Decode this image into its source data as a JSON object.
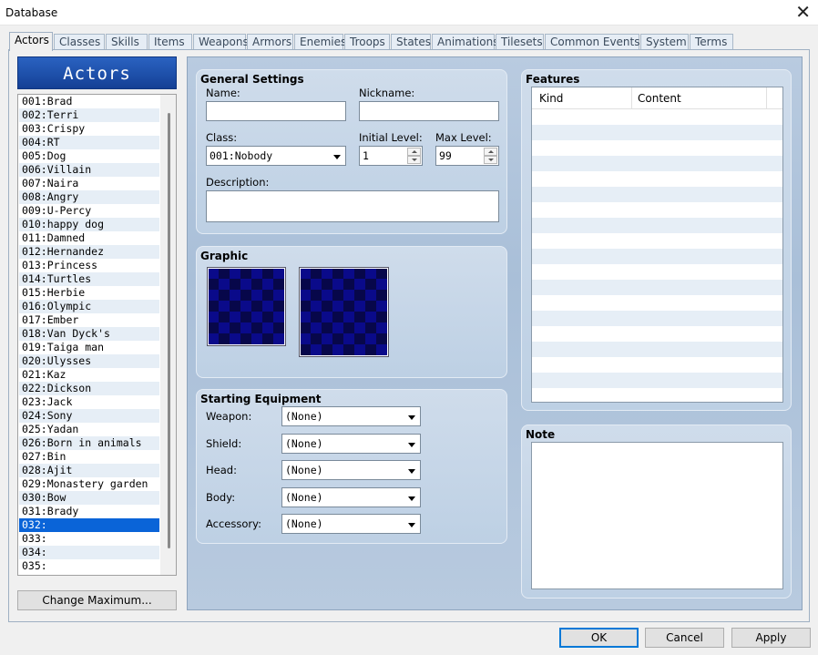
{
  "window": {
    "title": "Database",
    "close_glyph": "✕"
  },
  "tabs": [
    "Actors",
    "Classes",
    "Skills",
    "Items",
    "Weapons",
    "Armors",
    "Enemies",
    "Troops",
    "States",
    "Animations",
    "Tilesets",
    "Common Events",
    "System",
    "Terms"
  ],
  "active_tab": "Actors",
  "actors_panel": {
    "header": "Actors",
    "items": [
      "001:Brad",
      "002:Terri",
      "003:Crispy",
      "004:RT",
      "005:Dog",
      "006:Villain",
      "007:Naira",
      "008:Angry",
      "009:U-Percy",
      "010:happy dog",
      "011:Damned",
      "012:Hernandez",
      "013:Princess",
      "014:Turtles",
      "015:Herbie",
      "016:Olympic",
      "017:Ember",
      "018:Van Dyck's",
      "019:Taiga man",
      "020:Ulysses",
      "021:Kaz",
      "022:Dickson",
      "023:Jack",
      "024:Sony",
      "025:Yadan",
      "026:Born in animals",
      "027:Bin",
      "028:Ajit",
      "029:Monastery garden",
      "030:Bow",
      "031:Brady",
      "032:",
      "033:",
      "034:",
      "035:"
    ],
    "selected_index": 31,
    "change_max_label": "Change Maximum..."
  },
  "general": {
    "title": "General Settings",
    "name_label": "Name:",
    "name_value": "",
    "nickname_label": "Nickname:",
    "nickname_value": "",
    "class_label": "Class:",
    "class_value": "001:Nobody",
    "initial_level_label": "Initial Level:",
    "initial_level_value": "1",
    "max_level_label": "Max Level:",
    "max_level_value": "99",
    "description_label": "Description:",
    "description_value": ""
  },
  "graphic": {
    "title": "Graphic"
  },
  "equipment": {
    "title": "Starting Equipment",
    "slots": [
      {
        "label": "Weapon:",
        "value": "(None)"
      },
      {
        "label": "Shield:",
        "value": "(None)"
      },
      {
        "label": "Head:",
        "value": "(None)"
      },
      {
        "label": "Body:",
        "value": "(None)"
      },
      {
        "label": "Accessory:",
        "value": "(None)"
      }
    ]
  },
  "features": {
    "title": "Features",
    "col_kind": "Kind",
    "col_content": "Content"
  },
  "note": {
    "title": "Note",
    "value": ""
  },
  "buttons": {
    "ok": "OK",
    "cancel": "Cancel",
    "apply": "Apply"
  },
  "colors": {
    "selection": "#0a64d8",
    "header_blue": "#1d4ea8",
    "panel_blue": "#b9cbe0"
  }
}
